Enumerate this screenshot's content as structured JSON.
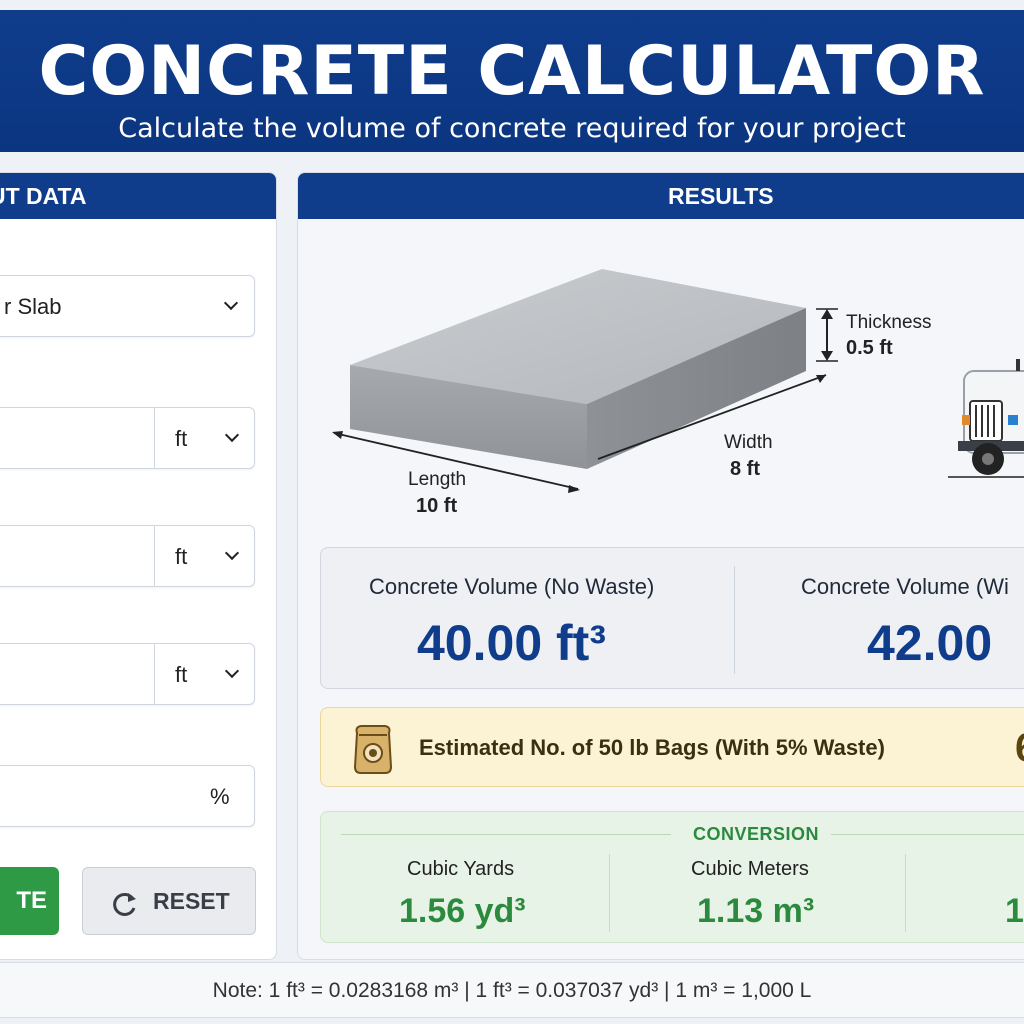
{
  "header": {
    "title": "CONCRETE CALCULATOR",
    "subtitle": "Calculate the volume of concrete required for your project"
  },
  "input_panel": {
    "title": "UT DATA",
    "shape_select": {
      "value": "r Slab"
    },
    "fields": [
      {
        "unit": "ft"
      },
      {
        "unit": "ft"
      },
      {
        "unit": "ft"
      }
    ],
    "waste_field": {
      "unit": "%"
    },
    "calculate_label": "TE",
    "reset_label": "RESET"
  },
  "results_panel": {
    "title": "RESULTS",
    "diagram": {
      "thickness_label": "Thickness",
      "thickness_value": "0.5 ft",
      "width_label": "Width",
      "width_value": "8 ft",
      "length_label": "Length",
      "length_value": "10 ft"
    },
    "volume_no_waste": {
      "label": "Concrete Volume (No Waste)",
      "value": "40.00 ft³"
    },
    "volume_with_waste": {
      "label": "Concrete Volume (Wi",
      "value": "42.00 "
    },
    "bags": {
      "label": "Estimated No. of 50 lb Bags (With 5% Waste)",
      "value": "6"
    },
    "conversion": {
      "title": "CONVERSION",
      "items": [
        {
          "label": "Cubic Yards",
          "value": "1.56 yd³"
        },
        {
          "label": "Cubic Meters",
          "value": "1.13 m³"
        },
        {
          "label": "",
          "value": "1"
        }
      ]
    }
  },
  "note": "Note: 1 ft³ = 0.0283168 m³  |  1 ft³ = 0.037037 yd³  |  1 m³ = 1,000 L",
  "colors": {
    "brand_blue": "#0f3d8c",
    "accent_green": "#2e9a46",
    "bags_bg": "#fcf3d4"
  }
}
